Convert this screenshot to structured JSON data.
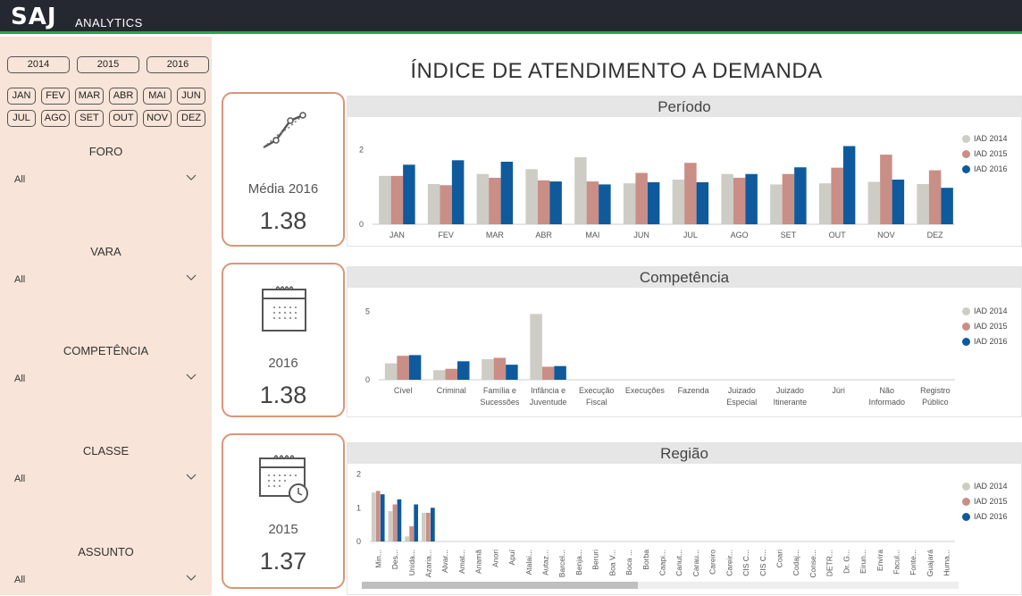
{
  "header": {
    "logo": "SAJ",
    "logo_sub": "ANALYTICS"
  },
  "sidebar": {
    "years": [
      "2014",
      "2015",
      "2016"
    ],
    "months_row1": [
      "JAN",
      "FEV",
      "MAR",
      "ABR",
      "MAI",
      "JUN"
    ],
    "months_row2": [
      "JUL",
      "AGO",
      "SET",
      "OUT",
      "NOV",
      "DEZ"
    ],
    "filters": [
      {
        "label": "FORO",
        "value": "All"
      },
      {
        "label": "VARA",
        "value": "All"
      },
      {
        "label": "COMPETÊNCIA",
        "value": "All"
      },
      {
        "label": "CLASSE",
        "value": "All"
      },
      {
        "label": "ASSUNTO",
        "value": "All"
      }
    ]
  },
  "page": {
    "title": "ÍNDICE DE ATENDIMENTO A DEMANDA"
  },
  "cards": [
    {
      "label": "Média 2016",
      "value": "1.38",
      "icon": "line-chart-icon"
    },
    {
      "label": "2016",
      "value": "1.38",
      "icon": "calendar-icon"
    },
    {
      "label": "2015",
      "value": "1.37",
      "icon": "calendar-clock-icon"
    }
  ],
  "legend": [
    "IAD 2014",
    "IAD 2015",
    "IAD 2016"
  ],
  "colors": {
    "s2014": "#cdcdc6",
    "s2015": "#c98e86",
    "s2016": "#0e5a9c",
    "accent": "#d8967a",
    "topbar": "#252830",
    "sidebar": "#f8e4d8"
  },
  "chart_data": [
    {
      "type": "bar",
      "title": "Período",
      "categories": [
        "JAN",
        "FEV",
        "MAR",
        "ABR",
        "MAI",
        "JUN",
        "JUL",
        "AGO",
        "SET",
        "OUT",
        "NOV",
        "DEZ"
      ],
      "series": [
        {
          "name": "IAD 2014",
          "values": [
            1.3,
            1.08,
            1.35,
            1.48,
            1.8,
            1.1,
            1.2,
            1.35,
            1.07,
            1.1,
            1.14,
            1.08
          ]
        },
        {
          "name": "IAD 2015",
          "values": [
            1.3,
            1.05,
            1.25,
            1.18,
            1.15,
            1.38,
            1.65,
            1.25,
            1.35,
            1.52,
            1.87,
            1.45
          ]
        },
        {
          "name": "IAD 2016",
          "values": [
            1.6,
            1.72,
            1.68,
            1.15,
            1.07,
            1.13,
            1.13,
            1.35,
            1.53,
            2.1,
            1.2,
            0.98
          ]
        }
      ],
      "yticks": [
        0,
        2
      ],
      "ylim": [
        0,
        2.4
      ],
      "legend": "top-right"
    },
    {
      "type": "bar",
      "title": "Competência",
      "categories": [
        "Cível",
        "Criminal",
        "Família e Sucessões",
        "Infância e Juventude",
        "Execução Fiscal",
        "Execuções",
        "Fazenda",
        "Juizado Especial",
        "Juizado Itinerante",
        "Júri",
        "Não Informado",
        "Registro Público"
      ],
      "series": [
        {
          "name": "IAD 2014",
          "values": [
            1.2,
            0.7,
            1.5,
            4.8,
            null,
            null,
            null,
            null,
            null,
            null,
            null,
            null
          ]
        },
        {
          "name": "IAD 2015",
          "values": [
            1.75,
            0.8,
            1.6,
            0.95,
            null,
            null,
            null,
            null,
            null,
            null,
            null,
            null
          ]
        },
        {
          "name": "IAD 2016",
          "values": [
            1.8,
            1.35,
            1.1,
            1.0,
            null,
            null,
            null,
            null,
            null,
            null,
            null,
            null
          ]
        }
      ],
      "yticks": [
        0,
        5
      ],
      "ylim": [
        0,
        6
      ],
      "legend": "top-right"
    },
    {
      "type": "bar",
      "title": "Região",
      "categories": [
        "Min...",
        "Des...",
        "Unida...",
        "Azaria...",
        "Alvar...",
        "Amat...",
        "Anamã",
        "Anori",
        "Apuí",
        "Atalai...",
        "Autaz...",
        "Barcel...",
        "Benja...",
        "Beruri",
        "Boa V...",
        "Boca ...",
        "Borba",
        "Caapi...",
        "Canut...",
        "Carau...",
        "Careiro",
        "Careir...",
        "CIS C...",
        "CIS C...",
        "Coari",
        "Codaj...",
        "Conse...",
        "DETR...",
        "Dr. G...",
        "Eirun...",
        "Envira",
        "Facul...",
        "Fonte...",
        "Guajará",
        "Huma..."
      ],
      "series": [
        {
          "name": "IAD 2014",
          "values": [
            1.45,
            0.9,
            0.15,
            0.85
          ]
        },
        {
          "name": "IAD 2015",
          "values": [
            1.5,
            1.1,
            0.45,
            0.85
          ]
        },
        {
          "name": "IAD 2016",
          "values": [
            1.4,
            1.25,
            1.1,
            1.0
          ]
        }
      ],
      "yticks": [
        0,
        1,
        2
      ],
      "ylim": [
        0,
        2.2
      ],
      "legend": "top-right"
    }
  ]
}
